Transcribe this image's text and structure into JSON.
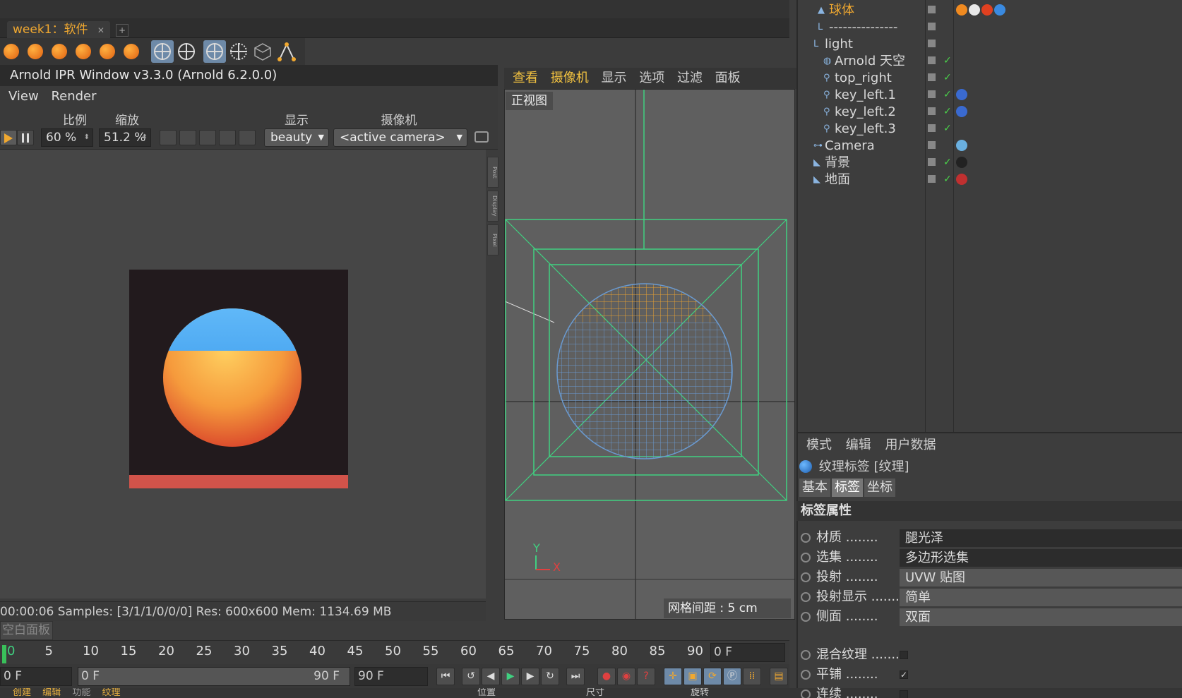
{
  "doc_tab": {
    "label": "week1：软件",
    "close": "✕"
  },
  "ipr": {
    "title": "Arnold IPR Window v3.3.0 (Arnold 6.2.0.0)",
    "menu": [
      "View",
      "Render"
    ],
    "labels": {
      "ratio": "比例",
      "zoom": "缩放",
      "display": "显示",
      "camera": "摄像机"
    },
    "ratio_value": "60 %",
    "zoom_value": "51.2 %",
    "display_value": "beauty",
    "camera_value": "<active camera>",
    "side_tabs": [
      "Post",
      "Display",
      "Pixel"
    ],
    "status": "00:00:06  Samples: [3/1/1/0/0/0]  Res: 600x600  Mem: 1134.69 MB"
  },
  "viewport": {
    "menu": [
      "查看",
      "摄像机",
      "显示",
      "选项",
      "过滤",
      "面板"
    ],
    "label": "正视图",
    "grid_spacing": "网格间距 : 5 cm",
    "axis_y": "Y",
    "axis_x": "X"
  },
  "objects": [
    {
      "name": "球体",
      "color": "#f0a830"
    },
    {
      "name": "---------------",
      "color": "#d8d8d8"
    },
    {
      "name": "light",
      "color": "#d8d8d8"
    },
    {
      "name": "Arnold 天空",
      "color": "#d8d8d8"
    },
    {
      "name": "top_right",
      "color": "#d8d8d8"
    },
    {
      "name": "key_left.1",
      "color": "#d8d8d8"
    },
    {
      "name": "key_left.2",
      "color": "#d8d8d8"
    },
    {
      "name": "key_left.3",
      "color": "#d8d8d8"
    },
    {
      "name": "Camera",
      "color": "#d8d8d8"
    },
    {
      "name": "背景",
      "color": "#d8d8d8"
    },
    {
      "name": "地面",
      "color": "#d8d8d8"
    }
  ],
  "attributes": {
    "menu": [
      "模式",
      "编辑",
      "用户数据"
    ],
    "title": "纹理标签 [纹理]",
    "tabs": [
      "基本",
      "标签",
      "坐标"
    ],
    "section": "标签属性",
    "rows": [
      {
        "label": "材质",
        "value": "腿光泽"
      },
      {
        "label": "选集",
        "value": "多边形选集"
      },
      {
        "label": "投射",
        "value": "UVW 贴图"
      },
      {
        "label": "投射显示",
        "value": "简单"
      },
      {
        "label": "侧面",
        "value": "双面"
      }
    ],
    "checks": [
      {
        "label": "混合纹理",
        "checked": ""
      },
      {
        "label": "平铺",
        "checked": "✓"
      },
      {
        "label": "连续",
        "checked": ""
      }
    ]
  },
  "timeline": {
    "blank_tab": "空白面板",
    "ticks": [
      "0",
      "5",
      "10",
      "15",
      "20",
      "25",
      "30",
      "35",
      "40",
      "45",
      "50",
      "55",
      "60",
      "65",
      "70",
      "75",
      "80",
      "85",
      "90"
    ],
    "current_frame": "0 F",
    "start": "0 F",
    "range_start": "0 F",
    "range_end": "90 F",
    "end": "90 F"
  },
  "bottom": [
    "创建",
    "编辑",
    "功能",
    "纹理",
    "位置",
    "尺寸",
    "旋转"
  ]
}
